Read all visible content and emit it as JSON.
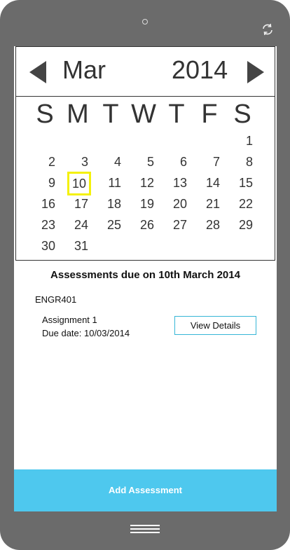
{
  "calendar": {
    "month": "Mar",
    "year": "2014",
    "weekdays": [
      "S",
      "M",
      "T",
      "W",
      "T",
      "F",
      "S"
    ],
    "selected_day": "10",
    "days": [
      "1",
      "2",
      "3",
      "4",
      "5",
      "6",
      "7",
      "8",
      "9",
      "10",
      "11",
      "12",
      "13",
      "14",
      "15",
      "16",
      "17",
      "18",
      "19",
      "20",
      "21",
      "22",
      "23",
      "24",
      "25",
      "26",
      "27",
      "28",
      "29",
      "30",
      "31"
    ]
  },
  "assessments": {
    "title": "Assessments due on 10th March 2014",
    "course": "ENGR401",
    "item": {
      "name": "Assignment 1",
      "due": "Due date: 10/03/2014",
      "button": "View Details"
    }
  },
  "actions": {
    "add": "Add Assessment"
  },
  "icons": {
    "prev": "left-arrow-icon",
    "next": "right-arrow-icon",
    "rotate": "rotate-icon",
    "menu": "menu-icon"
  },
  "colors": {
    "phone_frame": "#6b6b6b",
    "accent": "#4ec8ee",
    "selected_outline": "#f4f10a"
  }
}
